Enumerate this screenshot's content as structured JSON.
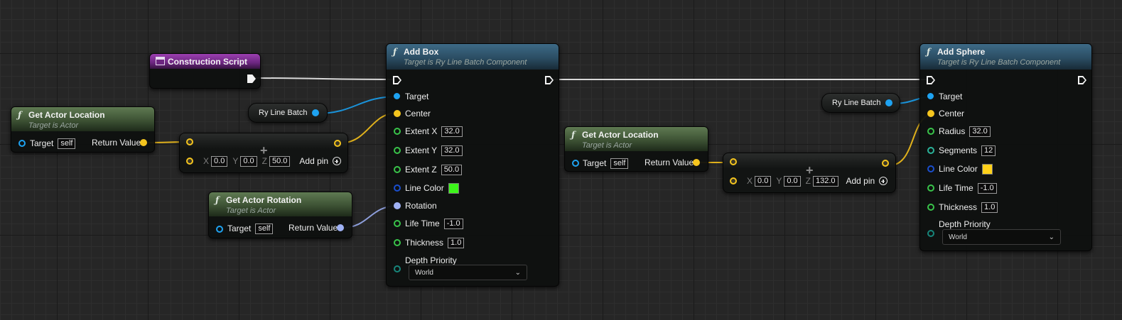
{
  "colors": {
    "exec": "#f3f3f3",
    "object_pin": "#1ea3f2",
    "vector_pin": "#f5c51e",
    "float_pin": "#39c44a",
    "color_pin": "#1a4fcf",
    "rotator_pin": "#9fb1f4",
    "byte_pin": "#17867b",
    "line_color_green": "#3cf51a",
    "line_color_yellow": "#ffd11a"
  },
  "construction": {
    "title": "Construction Script",
    "icon": "script-icon"
  },
  "get_loc_1": {
    "title": "Get Actor Location",
    "subtitle": "Target is Actor",
    "target_label": "Target",
    "target_value": "self",
    "return_label": "Return Value"
  },
  "get_rot": {
    "title": "Get Actor Rotation",
    "subtitle": "Target is Actor",
    "target_label": "Target",
    "target_value": "self",
    "return_label": "Return Value"
  },
  "get_loc_2": {
    "title": "Get Actor Location",
    "subtitle": "Target is Actor",
    "target_label": "Target",
    "target_value": "self",
    "return_label": "Return Value"
  },
  "ry_batch_1": {
    "label": "Ry Line Batch"
  },
  "ry_batch_2": {
    "label": "Ry Line Batch"
  },
  "add_vec_1": {
    "x_label": "X",
    "x_value": "0.0",
    "y_label": "Y",
    "y_value": "0.0",
    "z_label": "Z",
    "z_value": "50.0",
    "add_pin": "Add pin"
  },
  "add_vec_2": {
    "x_label": "X",
    "x_value": "0.0",
    "y_label": "Y",
    "y_value": "0.0",
    "z_label": "Z",
    "z_value": "132.0",
    "add_pin": "Add pin"
  },
  "add_box": {
    "title": "Add Box",
    "subtitle": "Target is Ry Line Batch Component",
    "target": "Target",
    "center": "Center",
    "extent_x": "Extent X",
    "extent_x_value": "32.0",
    "extent_y": "Extent Y",
    "extent_y_value": "32.0",
    "extent_z": "Extent Z",
    "extent_z_value": "50.0",
    "line_color": "Line Color",
    "rotation": "Rotation",
    "life_time": "Life Time",
    "life_time_value": "-1.0",
    "thickness": "Thickness",
    "thickness_value": "1.0",
    "depth_priority": "Depth Priority",
    "depth_value": "World"
  },
  "add_sphere": {
    "title": "Add Sphere",
    "subtitle": "Target is Ry Line Batch Component",
    "target": "Target",
    "center": "Center",
    "radius": "Radius",
    "radius_value": "32.0",
    "segments": "Segments",
    "segments_value": "12",
    "line_color": "Line Color",
    "life_time": "Life Time",
    "life_time_value": "-1.0",
    "thickness": "Thickness",
    "thickness_value": "1.0",
    "depth_priority": "Depth Priority",
    "depth_value": "World"
  }
}
